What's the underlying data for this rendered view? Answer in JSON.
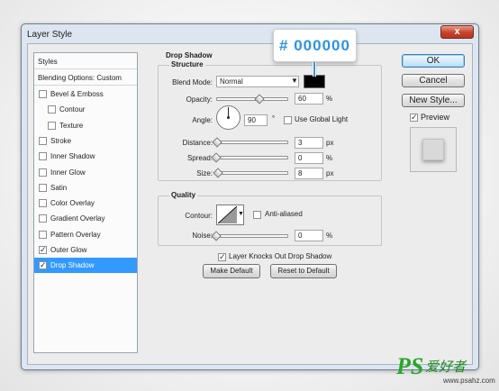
{
  "window": {
    "title": "Layer Style",
    "close_glyph": "x"
  },
  "styles_panel": {
    "header": "Styles",
    "blending_options": "Blending Options: Custom",
    "items": [
      {
        "label": "Bevel & Emboss",
        "checked": false,
        "sub": false,
        "selected": false
      },
      {
        "label": "Contour",
        "checked": false,
        "sub": true,
        "selected": false
      },
      {
        "label": "Texture",
        "checked": false,
        "sub": true,
        "selected": false
      },
      {
        "label": "Stroke",
        "checked": false,
        "sub": false,
        "selected": false
      },
      {
        "label": "Inner Shadow",
        "checked": false,
        "sub": false,
        "selected": false
      },
      {
        "label": "Inner Glow",
        "checked": false,
        "sub": false,
        "selected": false
      },
      {
        "label": "Satin",
        "checked": false,
        "sub": false,
        "selected": false
      },
      {
        "label": "Color Overlay",
        "checked": false,
        "sub": false,
        "selected": false
      },
      {
        "label": "Gradient Overlay",
        "checked": false,
        "sub": false,
        "selected": false
      },
      {
        "label": "Pattern Overlay",
        "checked": false,
        "sub": false,
        "selected": false
      },
      {
        "label": "Outer Glow",
        "checked": true,
        "sub": false,
        "selected": false
      },
      {
        "label": "Drop Shadow",
        "checked": true,
        "sub": false,
        "selected": true
      }
    ]
  },
  "drop_shadow": {
    "section_title": "Drop Shadow",
    "structure": {
      "title": "Structure",
      "blend_mode_label": "Blend Mode:",
      "blend_mode_value": "Normal",
      "shadow_color": "#000000",
      "opacity_label": "Opacity:",
      "opacity_value": "60",
      "opacity_unit": "%",
      "opacity_level": 60,
      "angle_label": "Angle:",
      "angle_value": "90",
      "angle_unit": "°",
      "use_global_light_label": "Use Global Light",
      "use_global_light_checked": false,
      "distance_label": "Distance:",
      "distance_value": "3",
      "distance_unit": "px",
      "distance_level": 1,
      "spread_label": "Spread:",
      "spread_value": "0",
      "spread_unit": "%",
      "spread_level": 0,
      "size_label": "Size:",
      "size_value": "8",
      "size_unit": "px",
      "size_level": 3
    },
    "quality": {
      "title": "Quality",
      "contour_label": "Contour:",
      "anti_aliased_label": "Anti-aliased",
      "anti_aliased_checked": false,
      "noise_label": "Noise:",
      "noise_value": "0",
      "noise_unit": "%",
      "noise_level": 0
    },
    "knockout_label": "Layer Knocks Out Drop Shadow",
    "knockout_checked": true,
    "make_default_label": "Make Default",
    "reset_default_label": "Reset to Default"
  },
  "buttons": {
    "ok": "OK",
    "cancel": "Cancel",
    "new_style": "New Style...",
    "preview_label": "Preview",
    "preview_checked": true
  },
  "callout": {
    "text": "# 000000"
  },
  "watermark": {
    "logo": "PS",
    "chinese": "爱好者",
    "url": "www.psahz.com"
  },
  "colors": {
    "accent": "#3399ff",
    "callout_text": "#2b94e0",
    "close_button": "#c8432a"
  }
}
